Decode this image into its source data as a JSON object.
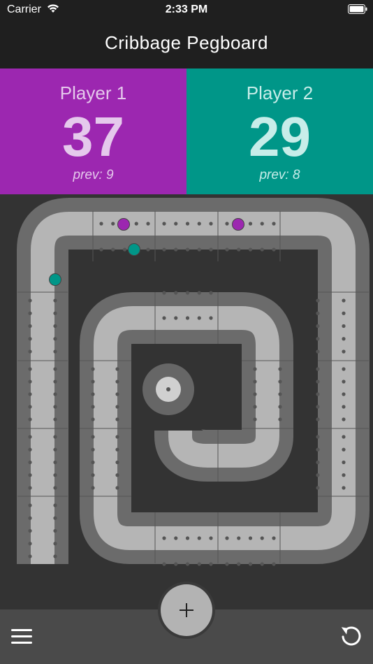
{
  "status_bar": {
    "carrier": "Carrier",
    "time": "2:33 PM"
  },
  "nav": {
    "title": "Cribbage Pegboard"
  },
  "players": [
    {
      "name": "Player 1",
      "score": "37",
      "prev": "prev: 9",
      "color": "#9c27b0",
      "text_color": "#e5c9ec"
    },
    {
      "name": "Player 2",
      "score": "29",
      "prev": "prev: 8",
      "color": "#009688",
      "text_color": "#c7ede9"
    }
  ],
  "colors": {
    "background": "#333333",
    "track_outer": "#6b6b6b",
    "track_inner": "#b5b5b5",
    "hole": "#555555",
    "toolbar": "#4a4a4a"
  },
  "toolbar": {
    "menu_icon": "hamburger-menu-icon",
    "add_icon": "plus-icon",
    "undo_icon": "undo-icon"
  }
}
